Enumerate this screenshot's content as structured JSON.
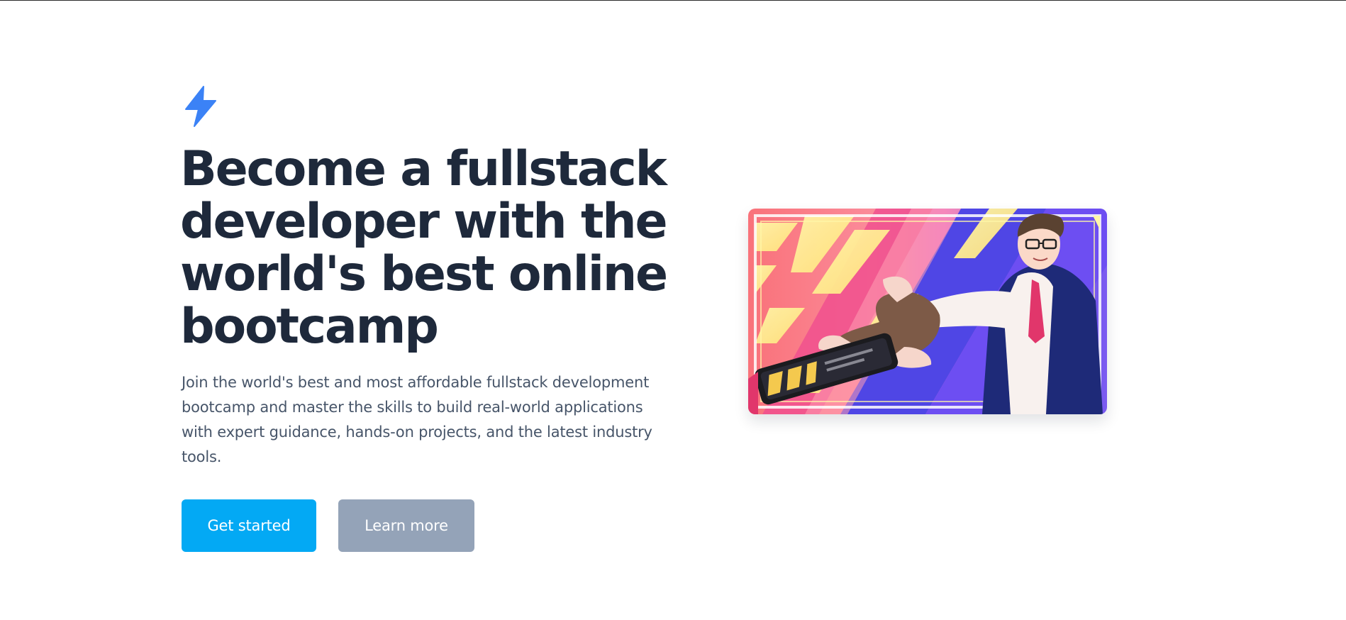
{
  "hero": {
    "logo_icon": "lightning-bolt-icon",
    "headline": "Become a fullstack developer with the world's best online bootcamp",
    "subtext": "Join the world's best and most affordable fullstack development bootcamp and master the skills to build real-world applications with expert guidance, hands-on projects, and the latest industry tools.",
    "primary_button": "Get started",
    "secondary_button": "Learn more",
    "illustration": "anime-developer-holding-phone-illustration"
  },
  "colors": {
    "accent": "#3b82f6",
    "heading": "#1e293b",
    "body_text": "#475569",
    "primary_button": "#03a9f4",
    "secondary_button": "#94a3b8"
  }
}
